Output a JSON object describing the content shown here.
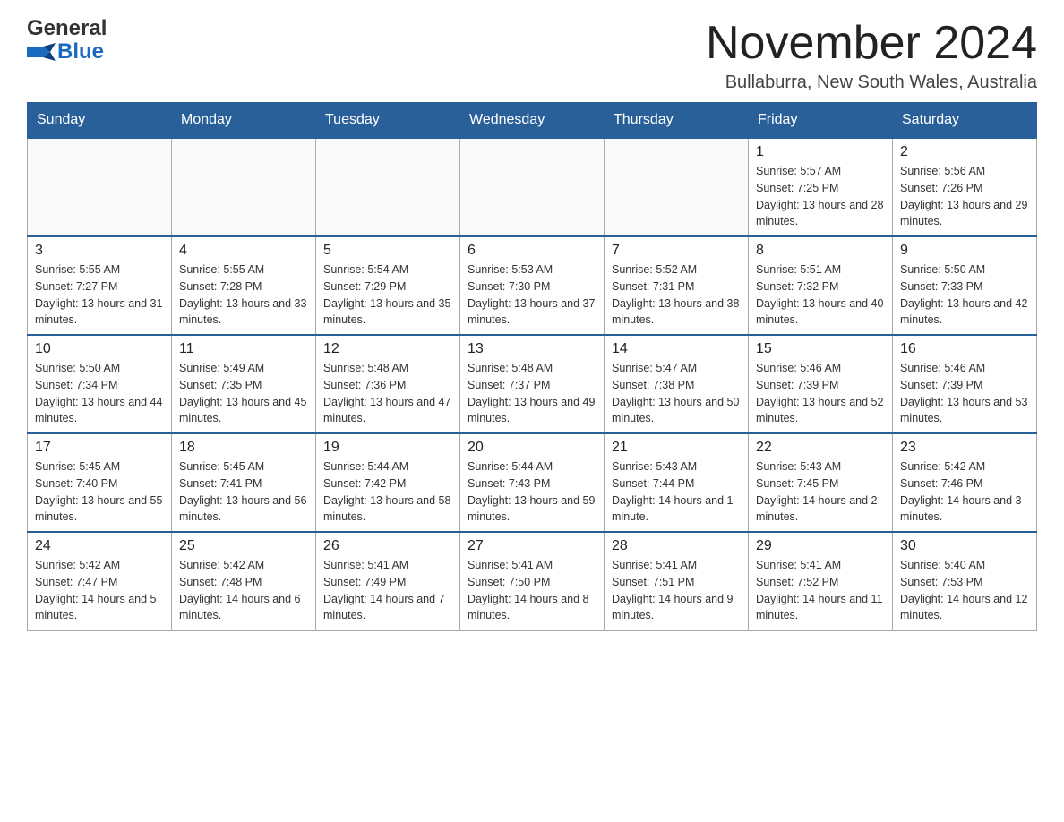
{
  "header": {
    "logo": {
      "general": "General",
      "blue": "Blue"
    },
    "month_title": "November 2024",
    "location": "Bullaburra, New South Wales, Australia"
  },
  "days_of_week": [
    "Sunday",
    "Monday",
    "Tuesday",
    "Wednesday",
    "Thursday",
    "Friday",
    "Saturday"
  ],
  "weeks": [
    [
      {
        "day": "",
        "sunrise": "",
        "sunset": "",
        "daylight": ""
      },
      {
        "day": "",
        "sunrise": "",
        "sunset": "",
        "daylight": ""
      },
      {
        "day": "",
        "sunrise": "",
        "sunset": "",
        "daylight": ""
      },
      {
        "day": "",
        "sunrise": "",
        "sunset": "",
        "daylight": ""
      },
      {
        "day": "",
        "sunrise": "",
        "sunset": "",
        "daylight": ""
      },
      {
        "day": "1",
        "sunrise": "Sunrise: 5:57 AM",
        "sunset": "Sunset: 7:25 PM",
        "daylight": "Daylight: 13 hours and 28 minutes."
      },
      {
        "day": "2",
        "sunrise": "Sunrise: 5:56 AM",
        "sunset": "Sunset: 7:26 PM",
        "daylight": "Daylight: 13 hours and 29 minutes."
      }
    ],
    [
      {
        "day": "3",
        "sunrise": "Sunrise: 5:55 AM",
        "sunset": "Sunset: 7:27 PM",
        "daylight": "Daylight: 13 hours and 31 minutes."
      },
      {
        "day": "4",
        "sunrise": "Sunrise: 5:55 AM",
        "sunset": "Sunset: 7:28 PM",
        "daylight": "Daylight: 13 hours and 33 minutes."
      },
      {
        "day": "5",
        "sunrise": "Sunrise: 5:54 AM",
        "sunset": "Sunset: 7:29 PM",
        "daylight": "Daylight: 13 hours and 35 minutes."
      },
      {
        "day": "6",
        "sunrise": "Sunrise: 5:53 AM",
        "sunset": "Sunset: 7:30 PM",
        "daylight": "Daylight: 13 hours and 37 minutes."
      },
      {
        "day": "7",
        "sunrise": "Sunrise: 5:52 AM",
        "sunset": "Sunset: 7:31 PM",
        "daylight": "Daylight: 13 hours and 38 minutes."
      },
      {
        "day": "8",
        "sunrise": "Sunrise: 5:51 AM",
        "sunset": "Sunset: 7:32 PM",
        "daylight": "Daylight: 13 hours and 40 minutes."
      },
      {
        "day": "9",
        "sunrise": "Sunrise: 5:50 AM",
        "sunset": "Sunset: 7:33 PM",
        "daylight": "Daylight: 13 hours and 42 minutes."
      }
    ],
    [
      {
        "day": "10",
        "sunrise": "Sunrise: 5:50 AM",
        "sunset": "Sunset: 7:34 PM",
        "daylight": "Daylight: 13 hours and 44 minutes."
      },
      {
        "day": "11",
        "sunrise": "Sunrise: 5:49 AM",
        "sunset": "Sunset: 7:35 PM",
        "daylight": "Daylight: 13 hours and 45 minutes."
      },
      {
        "day": "12",
        "sunrise": "Sunrise: 5:48 AM",
        "sunset": "Sunset: 7:36 PM",
        "daylight": "Daylight: 13 hours and 47 minutes."
      },
      {
        "day": "13",
        "sunrise": "Sunrise: 5:48 AM",
        "sunset": "Sunset: 7:37 PM",
        "daylight": "Daylight: 13 hours and 49 minutes."
      },
      {
        "day": "14",
        "sunrise": "Sunrise: 5:47 AM",
        "sunset": "Sunset: 7:38 PM",
        "daylight": "Daylight: 13 hours and 50 minutes."
      },
      {
        "day": "15",
        "sunrise": "Sunrise: 5:46 AM",
        "sunset": "Sunset: 7:39 PM",
        "daylight": "Daylight: 13 hours and 52 minutes."
      },
      {
        "day": "16",
        "sunrise": "Sunrise: 5:46 AM",
        "sunset": "Sunset: 7:39 PM",
        "daylight": "Daylight: 13 hours and 53 minutes."
      }
    ],
    [
      {
        "day": "17",
        "sunrise": "Sunrise: 5:45 AM",
        "sunset": "Sunset: 7:40 PM",
        "daylight": "Daylight: 13 hours and 55 minutes."
      },
      {
        "day": "18",
        "sunrise": "Sunrise: 5:45 AM",
        "sunset": "Sunset: 7:41 PM",
        "daylight": "Daylight: 13 hours and 56 minutes."
      },
      {
        "day": "19",
        "sunrise": "Sunrise: 5:44 AM",
        "sunset": "Sunset: 7:42 PM",
        "daylight": "Daylight: 13 hours and 58 minutes."
      },
      {
        "day": "20",
        "sunrise": "Sunrise: 5:44 AM",
        "sunset": "Sunset: 7:43 PM",
        "daylight": "Daylight: 13 hours and 59 minutes."
      },
      {
        "day": "21",
        "sunrise": "Sunrise: 5:43 AM",
        "sunset": "Sunset: 7:44 PM",
        "daylight": "Daylight: 14 hours and 1 minute."
      },
      {
        "day": "22",
        "sunrise": "Sunrise: 5:43 AM",
        "sunset": "Sunset: 7:45 PM",
        "daylight": "Daylight: 14 hours and 2 minutes."
      },
      {
        "day": "23",
        "sunrise": "Sunrise: 5:42 AM",
        "sunset": "Sunset: 7:46 PM",
        "daylight": "Daylight: 14 hours and 3 minutes."
      }
    ],
    [
      {
        "day": "24",
        "sunrise": "Sunrise: 5:42 AM",
        "sunset": "Sunset: 7:47 PM",
        "daylight": "Daylight: 14 hours and 5 minutes."
      },
      {
        "day": "25",
        "sunrise": "Sunrise: 5:42 AM",
        "sunset": "Sunset: 7:48 PM",
        "daylight": "Daylight: 14 hours and 6 minutes."
      },
      {
        "day": "26",
        "sunrise": "Sunrise: 5:41 AM",
        "sunset": "Sunset: 7:49 PM",
        "daylight": "Daylight: 14 hours and 7 minutes."
      },
      {
        "day": "27",
        "sunrise": "Sunrise: 5:41 AM",
        "sunset": "Sunset: 7:50 PM",
        "daylight": "Daylight: 14 hours and 8 minutes."
      },
      {
        "day": "28",
        "sunrise": "Sunrise: 5:41 AM",
        "sunset": "Sunset: 7:51 PM",
        "daylight": "Daylight: 14 hours and 9 minutes."
      },
      {
        "day": "29",
        "sunrise": "Sunrise: 5:41 AM",
        "sunset": "Sunset: 7:52 PM",
        "daylight": "Daylight: 14 hours and 11 minutes."
      },
      {
        "day": "30",
        "sunrise": "Sunrise: 5:40 AM",
        "sunset": "Sunset: 7:53 PM",
        "daylight": "Daylight: 14 hours and 12 minutes."
      }
    ]
  ]
}
